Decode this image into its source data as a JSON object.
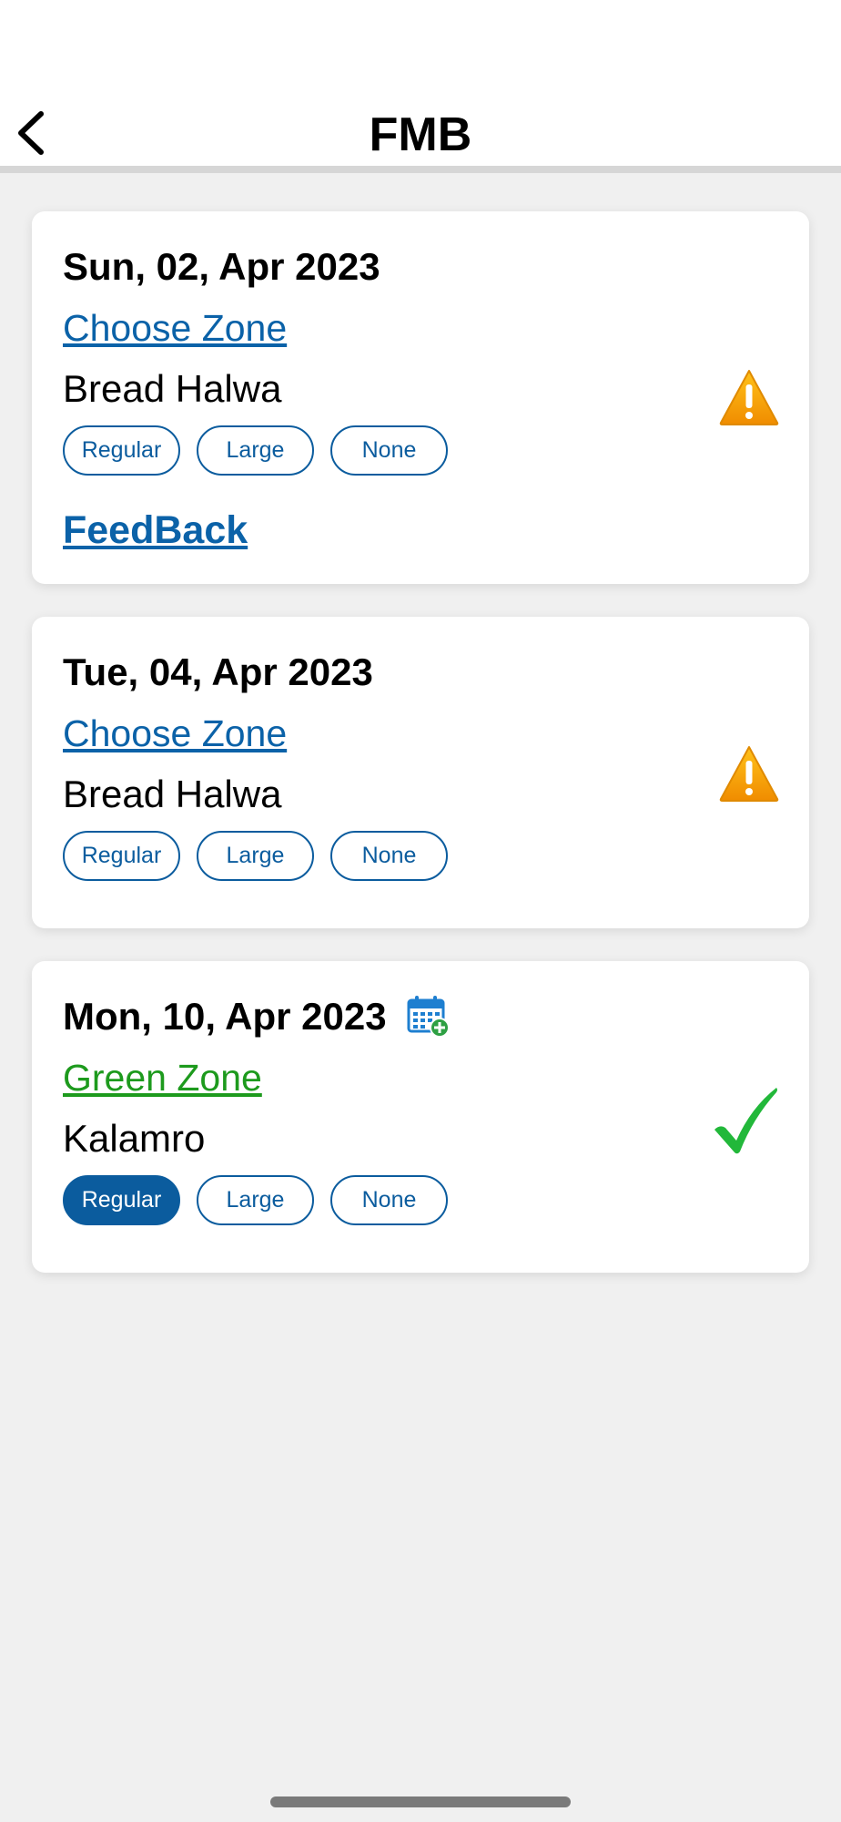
{
  "header": {
    "title": "FMB",
    "back_icon": "chevron-left-icon"
  },
  "colors": {
    "accent": "#0b5c9e",
    "link": "#0b62a8",
    "green_zone": "#1d9a1d",
    "warning": "#f5a300",
    "success": "#22b83a",
    "background": "#f0f0f0"
  },
  "entries": [
    {
      "date": "Sun, 02, Apr 2023",
      "zone": "Choose Zone",
      "dish": "Bread Halwa",
      "options": [
        "Regular",
        "Large",
        "None"
      ],
      "selected": null,
      "feedback": "FeedBack",
      "status_icon": "warning-icon"
    },
    {
      "date": "Tue, 04, Apr 2023",
      "zone": "Choose Zone",
      "dish": "Bread Halwa",
      "options": [
        "Regular",
        "Large",
        "None"
      ],
      "selected": null,
      "status_icon": "warning-icon"
    },
    {
      "date": "Mon, 10, Apr 2023",
      "zone": "Green Zone",
      "dish": "Kalamro",
      "options": [
        "Regular",
        "Large",
        "None"
      ],
      "selected": "Regular",
      "date_icon": "calendar-add-icon",
      "status_icon": "checkmark-icon"
    }
  ]
}
